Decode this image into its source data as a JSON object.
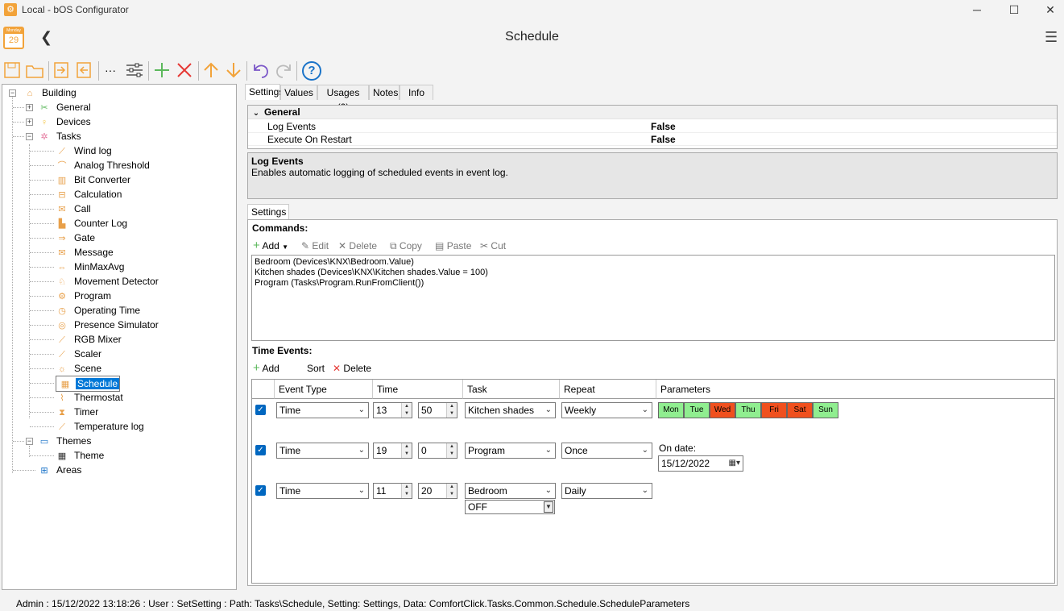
{
  "window": {
    "title": "Local - bOS Configurator",
    "minimize": "─",
    "maximize": "☐",
    "close": "✕"
  },
  "calendar": {
    "weekday": "Monday",
    "day": "29"
  },
  "header": {
    "title": "Schedule",
    "back": "❮",
    "menu": "☰"
  },
  "toolbar": {
    "icons": [
      "save-icon",
      "open-folder-icon",
      "import-icon",
      "export-icon",
      "more-icon",
      "settings-sliders-icon",
      "add-icon",
      "delete-icon",
      "move-up-icon",
      "move-down-icon",
      "undo-icon",
      "redo-icon",
      "help-icon"
    ],
    "more": "···",
    "help": "?"
  },
  "tree": {
    "root": "Building",
    "general": "General",
    "devices": "Devices",
    "tasks": "Tasks",
    "task_items": [
      "Wind log",
      "Analog Threshold",
      "Bit Converter",
      "Calculation",
      "Call",
      "Counter Log",
      "Gate",
      "Message",
      "MinMaxAvg",
      "Movement Detector",
      "Program",
      "Operating Time",
      "Presence Simulator",
      "RGB Mixer",
      "Scaler",
      "Scene",
      "Schedule",
      "Thermostat",
      "Timer",
      "Temperature log"
    ],
    "selected": "Schedule",
    "themes": "Themes",
    "theme": "Theme",
    "areas": "Areas"
  },
  "tabs": [
    "Settings",
    "Values",
    "Usages (0)",
    "Notes",
    "Info"
  ],
  "properties": {
    "category": "General",
    "rows": [
      {
        "name": "Log Events",
        "value": "False"
      },
      {
        "name": "Execute On Restart",
        "value": "False"
      }
    ]
  },
  "description": {
    "title": "Log Events",
    "text": "Enables automatic logging of scheduled events in event log."
  },
  "subtab": "Settings",
  "commands": {
    "label": "Commands:",
    "buttons": {
      "add": "Add",
      "edit": "Edit",
      "delete": "Delete",
      "copy": "Copy",
      "paste": "Paste",
      "cut": "Cut"
    },
    "items": [
      "Bedroom (Devices\\KNX\\Bedroom.Value)",
      "Kitchen shades (Devices\\KNX\\Kitchen shades.Value = 100)",
      "Program (Tasks\\Program.RunFromClient())"
    ]
  },
  "time_events": {
    "label": "Time Events:",
    "buttons": {
      "add": "Add",
      "sort": "Sort",
      "delete": "Delete"
    },
    "columns": [
      "Event Type",
      "Time",
      "Task",
      "Repeat",
      "Parameters"
    ],
    "rows": [
      {
        "type": "Time",
        "hour": "13",
        "minute": "50",
        "task": "Kitchen shades",
        "repeat": "Weekly"
      },
      {
        "type": "Time",
        "hour": "19",
        "minute": "0",
        "task": "Program",
        "repeat": "Once",
        "on_date_label": "On date:",
        "on_date": "15/12/2022"
      },
      {
        "type": "Time",
        "hour": "11",
        "minute": "20",
        "task": "Bedroom",
        "task_value": "OFF",
        "repeat": "Daily"
      }
    ],
    "days": [
      {
        "label": "Mon",
        "active": false
      },
      {
        "label": "Tue",
        "active": false
      },
      {
        "label": "Wed",
        "active": true
      },
      {
        "label": "Thu",
        "active": false
      },
      {
        "label": "Fri",
        "active": true
      },
      {
        "label": "Sat",
        "active": true
      },
      {
        "label": "Sun",
        "active": false
      }
    ],
    "day_colors": {
      "active": "#f0501e",
      "inactive": "#90ee90"
    }
  },
  "status": "Admin : 15/12/2022 13:18:26 : User : SetSetting : Path: Tasks\\Schedule, Setting: Settings, Data: ComfortClick.Tasks.Common.Schedule.ScheduleParameters",
  "colors": {
    "accent": "#f2a33a",
    "selection": "#0078d7"
  }
}
